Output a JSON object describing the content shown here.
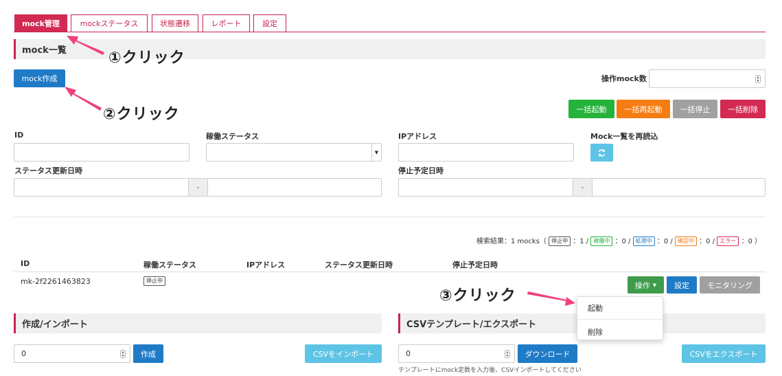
{
  "tabs": [
    {
      "label": "mock管理",
      "active": true
    },
    {
      "label": "mockステータス"
    },
    {
      "label": "状態遷移"
    },
    {
      "label": "レポート"
    },
    {
      "label": "設定"
    }
  ],
  "list_section": {
    "title": "mock一覧"
  },
  "create_mock_button": "mock作成",
  "operation_count": {
    "label": "操作mock数",
    "value": ""
  },
  "bulk_buttons": {
    "start": "一括起動",
    "restart": "一括再起動",
    "stop": "一括停止",
    "delete": "一括削除"
  },
  "filters": {
    "id_label": "ID",
    "status_label": "稼働ステータス",
    "ip_label": "IPアドレス",
    "reload_label": "Mock一覧を再読込",
    "updated_label": "ステータス更新日時",
    "stop_label": "停止予定日時",
    "range_separator": "-"
  },
  "search_result": {
    "prefix": "検索結果：1 mocks（",
    "stopped_badge": "停止中",
    "stopped_count": "：1 /",
    "running_badge": "稼働中",
    "running_count": "：0 /",
    "processing_badge": "処理中",
    "processing_count": "：0 /",
    "confirming_badge": "確認中",
    "confirming_count": "：0 /",
    "error_badge": "エラー",
    "error_count": "：0 ）"
  },
  "table": {
    "headers": [
      "ID",
      "稼働ステータス",
      "IPアドレス",
      "ステータス更新日時",
      "停止予定日時"
    ],
    "rows": [
      {
        "id": "mk-2f2261463823",
        "status": "停止中",
        "ip": "",
        "updated": "",
        "stop": ""
      }
    ]
  },
  "row_actions": {
    "operate": "操作",
    "settings": "設定",
    "monitoring": "モニタリング"
  },
  "dropdown_menu": {
    "start": "起動",
    "delete": "削除"
  },
  "import_section": {
    "title": "作成/インポート",
    "value": "0",
    "create_button": "作成",
    "csv_import_button": "CSVをインポート"
  },
  "export_section": {
    "title": "CSVテンプレート/エクスポート",
    "value": "0",
    "download_button": "ダウンロード",
    "csv_export_button": "CSVをエクスポート",
    "hint": "テンプレートにmock定数を入力後、CSVインポートしてください"
  },
  "annotations": {
    "step1": "①クリック",
    "step2": "②クリック",
    "step3": "③クリック"
  },
  "colors": {
    "accent": "#c7254e",
    "primary": "#1f7bc6",
    "success": "#25b33b",
    "warning": "#f57c13",
    "annotation_arrow": "#f0407a"
  }
}
